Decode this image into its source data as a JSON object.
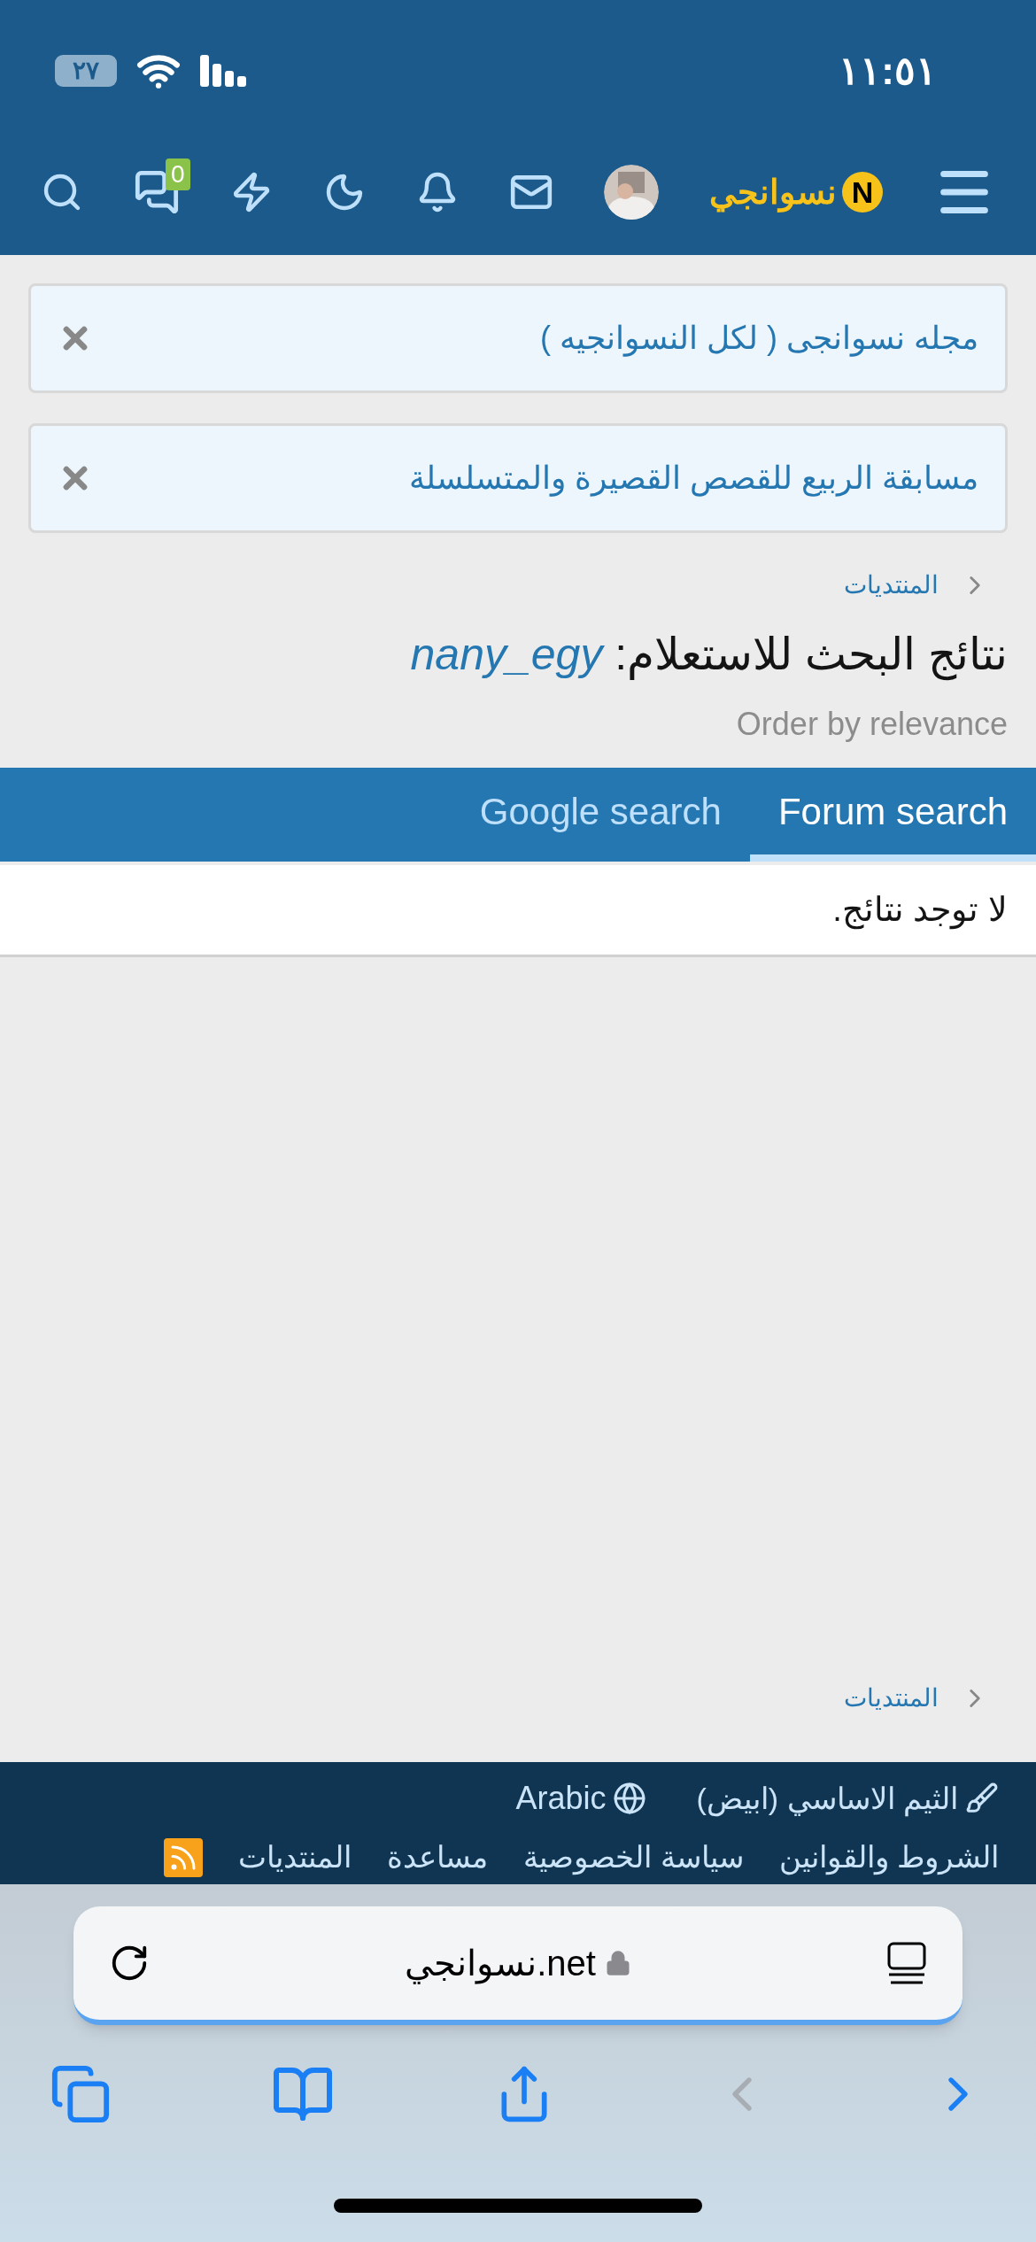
{
  "status_bar": {
    "time": "١١:٥١",
    "battery": "٢٧"
  },
  "header": {
    "logo_badge": "N",
    "logo_text": "نسوانجي",
    "message_count": "0"
  },
  "notices": [
    {
      "text": "مجله نسوانجى ( لكل النسوانجيه )"
    },
    {
      "text": "مسابقة الربيع للقصص القصيرة والمتسلسلة"
    }
  ],
  "breadcrumb_top": "المنتديات",
  "title": {
    "text": "نتائج البحث للاستعلام:",
    "query": "nany_egy"
  },
  "order": "Order by relevance",
  "tabs": [
    {
      "label": "Forum search",
      "selected": true
    },
    {
      "label": "Google search",
      "selected": false
    }
  ],
  "result": "لا توجد نتائج.",
  "breadcrumb_bottom": "المنتديات",
  "footer": {
    "theme": "الثيم الاساسي (ابيض)",
    "language": "Arabic",
    "links": [
      "الشروط والقوانين",
      "سياسة الخصوصية",
      "مساعدة",
      "المنتديات"
    ]
  },
  "browser": {
    "url": "نسوانجي.net"
  }
}
